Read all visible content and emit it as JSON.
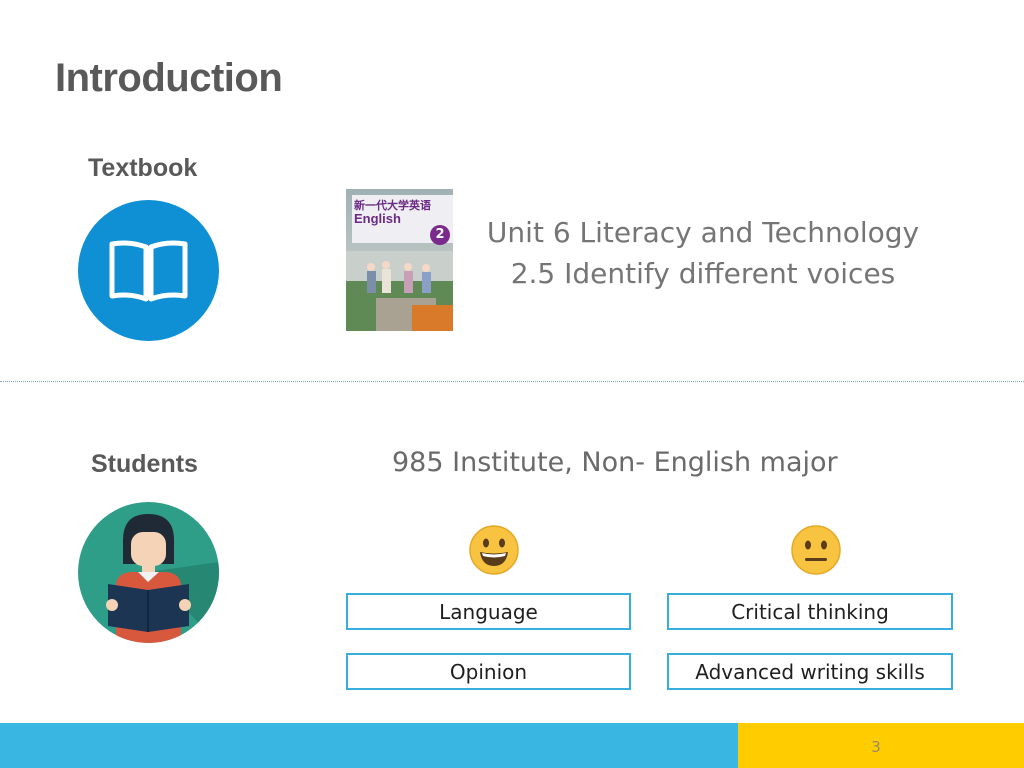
{
  "slide": {
    "title": "Introduction",
    "page_number": "3"
  },
  "textbook": {
    "label": "Textbook",
    "icon": "open-book-icon",
    "cover_title_cn": "新一代大学英语",
    "cover_title_en": "English",
    "cover_volume": "2",
    "unit_line1": "Unit 6 Literacy and Technology",
    "unit_line2": "2.5 Identify different voices"
  },
  "students": {
    "label": "Students",
    "icon": "reading-student-icon",
    "info": "985 Institute, Non- English major",
    "strengths_icon": "grinning-face-icon",
    "neutral_icon": "neutral-face-icon",
    "strengths": [
      "Language",
      "Opinion"
    ],
    "weaknesses": [
      "Critical thinking",
      "Advanced writing skills"
    ]
  },
  "colors": {
    "accent_blue": "#3ab6e3",
    "icon_blue": "#0f8fd4",
    "icon_teal": "#2e9e88",
    "footer_yellow": "#ffcc00",
    "box_border": "#36aee0"
  }
}
